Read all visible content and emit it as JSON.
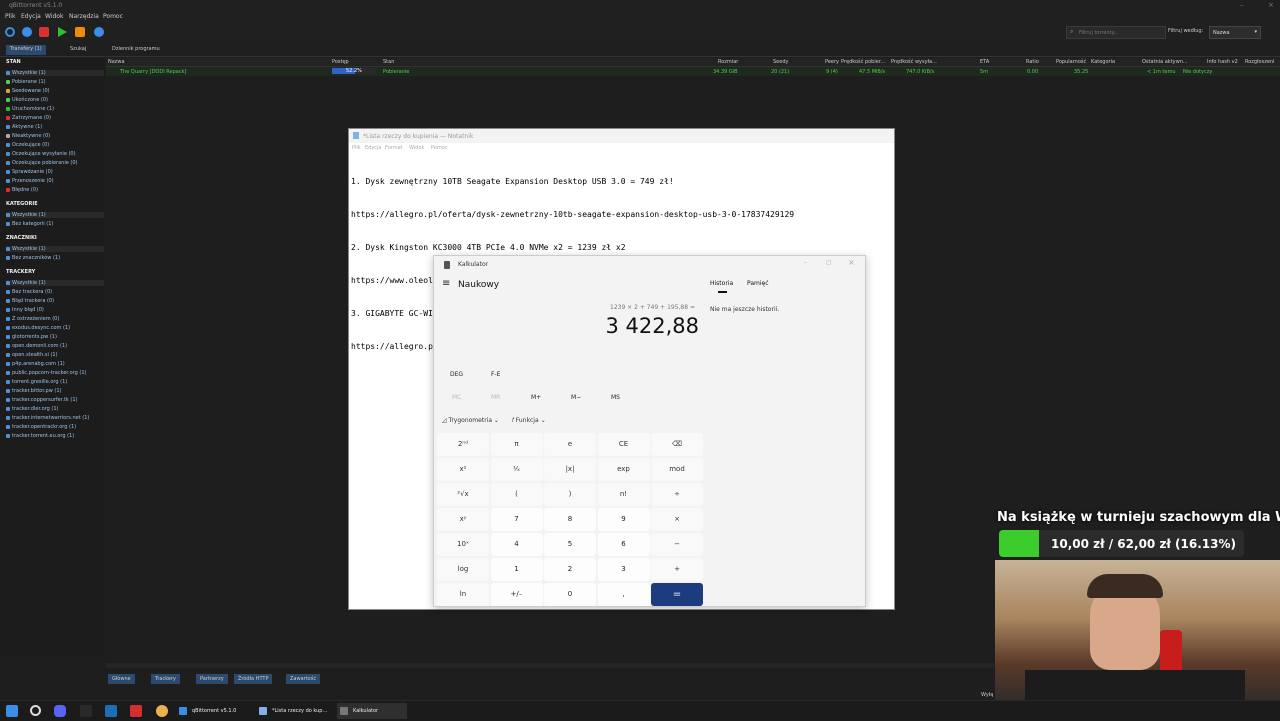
{
  "qbittorrent": {
    "title": "qBittorrent v5.1.0",
    "menu": [
      "Plik",
      "Edycja",
      "Widok",
      "Narzędzia",
      "Pomoc"
    ],
    "search_placeholder": "Filtruj torrenty...",
    "filter_label": "Filtruj według:",
    "filter_value": "Nazwa",
    "tabs": [
      "Transfery (1)",
      "Szukaj",
      "Dziennik programu"
    ],
    "sidebar": {
      "stan_title": "STAN",
      "stan": [
        "Wszystkie (1)",
        "Pobierane (1)",
        "Seedowane (0)",
        "Ukończone (0)",
        "Uruchomione (1)",
        "Zatrzymane (0)",
        "Aktywne (1)",
        "Nieaktywne (0)",
        "Oczekujące (0)",
        "Oczekujące wysyłanie (0)",
        "Oczekujące pobieranie (0)",
        "Sprawdzanie (0)",
        "Przenoszenie (0)",
        "Błędne (0)"
      ],
      "kategorie_title": "KATEGORIE",
      "kategorie": [
        "Wszystkie (1)",
        "Bez kategorii (1)"
      ],
      "znaczniki_title": "ZNACZNIKI",
      "znaczniki": [
        "Wszystkie (1)",
        "Bez znaczników (1)"
      ],
      "trackery_title": "TRACKERY",
      "trackery": [
        "Wszystkie (1)",
        "Bez trackera (0)",
        "Błąd trackera (0)",
        "Inny błąd (0)",
        "Z ostrzeżeniem (0)",
        "exodus.desync.com (1)",
        "glotorrents.pw (1)",
        "open.demonii.com (1)",
        "open.stealth.si (1)",
        "p4p.arenabg.com (1)",
        "public.popcorn-tracker.org (1)",
        "torrent.gresille.org (1)",
        "tracker.bittor.pw (1)",
        "tracker.coppersurfer.tk (1)",
        "tracker.dler.org (1)",
        "tracker.internetwarriors.net (1)",
        "tracker.opentrackr.org (1)",
        "tracker.torrent.eu.org (1)"
      ]
    },
    "columns": [
      "Nazwa",
      "Postęp",
      "Stan",
      "Rozmiar",
      "Seedy",
      "Peery",
      "Prędkość pobier...",
      "Prędkość wysyła...",
      "ETA",
      "Ratio",
      "Popularność",
      "Kategoria",
      "Ostatnia aktywn...",
      "Info hash v2",
      "Rozgłoszeni"
    ],
    "torrent": {
      "name": "The Quarry [DODI Repack]",
      "progress_text": "52.2%",
      "progress": 0.522,
      "state": "Pobieranie",
      "size": "34.39 GiB",
      "seeds": "20 (21)",
      "peers": "9 (4)",
      "down": "47.5 MiB/s",
      "up": "747.0 KiB/s",
      "eta": "5m",
      "ratio": "0.00",
      "popularity": "35.25",
      "last": "< 1m temu",
      "hash": "Nie dotyczy"
    },
    "bottom_tabs": [
      "Główne",
      "Trackery",
      "Partnerzy",
      "Źródła HTTP",
      "Zawartość"
    ]
  },
  "notepad": {
    "title": "*Lista rzeczy do kupienia — Notatnik",
    "menu": [
      "Plik",
      "Edycja",
      "Format",
      "Widok",
      "Pomoc"
    ],
    "lines": [
      "1. Dysk zewnętrzny 10TB Seagate Expansion Desktop USB 3.0 = 749 zł!",
      "https://allegro.pl/oferta/dysk-zewnetrzny-10tb-seagate-expansion-desktop-usb-3-0-17837429129",
      "2. Dysk Kingston KC3000 4TB PCIe 4.0 NVMe x2 = 1239 zł x2",
      "https://www.oleole.pl/dyski-wewnetrzne-ssd/kingston-kc3000-4tb-pcie-4-0-nvme.bhtml",
      "3. GIGABYTE GC-WIFI7 Wi-Fi 7 Bluetooth 5.3 Rev1.0 Qualcomm = 195,88 zł",
      "https://allegro.pl/oferta/gigabyte-gc-wifi7-wi-fi-7-bluetooth-5-3-rev1-0-qualcomm-15558843116"
    ]
  },
  "calculator": {
    "title": "Kalkulator",
    "mode": "Naukowy",
    "expression": "1239 × 2 + 749 + 195,88 =",
    "result": "3 422,88",
    "history_tab": "Historia",
    "memory_tab": "Pamięć",
    "history_empty": "Nie ma jeszcze historii.",
    "deg": "DEG",
    "fe": "F-E",
    "memory_keys": [
      "MC",
      "MR",
      "M+",
      "M−",
      "MS"
    ],
    "trig": "Trygonometria",
    "func": "Funkcja",
    "keys": [
      [
        "2ⁿᵈ",
        "π",
        "e",
        "CE",
        "⌫"
      ],
      [
        "x²",
        "¹⁄ₓ",
        "|x|",
        "exp",
        "mod"
      ],
      [
        "²√x",
        "(",
        ")",
        "n!",
        "÷"
      ],
      [
        "xʸ",
        "7",
        "8",
        "9",
        "×"
      ],
      [
        "10ˣ",
        "4",
        "5",
        "6",
        "−"
      ],
      [
        "log",
        "1",
        "2",
        "3",
        "+"
      ],
      [
        "ln",
        "+/₋",
        "0",
        ",",
        "="
      ]
    ]
  },
  "overlay": {
    "title": "Na książkę w turnieju szachowym dla Was!",
    "amount": "10,00 zł / 62,00 zł (16.13%)",
    "fraction": 0.1613
  },
  "taskbar": {
    "apps": [
      "qBittorrent v5.1.0",
      "*Lista rzeczy do kup...",
      "Kalkulator"
    ],
    "tray": "Wyłą"
  }
}
